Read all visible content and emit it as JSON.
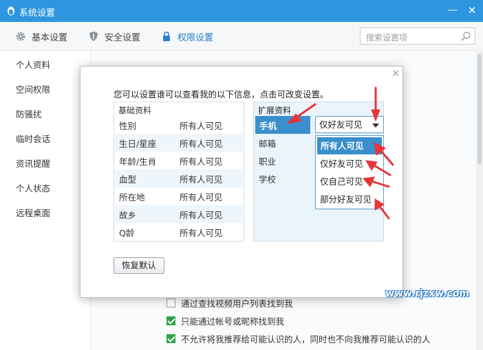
{
  "window": {
    "title": "系统设置",
    "minimize_icon": "minimize-icon",
    "close_icon": "close-icon"
  },
  "tabs": [
    {
      "label": "基本设置",
      "icon": "gear-icon"
    },
    {
      "label": "安全设置",
      "icon": "shield-icon"
    },
    {
      "label": "权限设置",
      "icon": "lock-icon",
      "active": true
    }
  ],
  "search": {
    "placeholder": "搜索设置项"
  },
  "sidebar": {
    "items": [
      {
        "label": "个人资料"
      },
      {
        "label": "空间权限"
      },
      {
        "label": "防骚扰"
      },
      {
        "label": "临时会话"
      },
      {
        "label": "资讯提醒"
      },
      {
        "label": "个人状态"
      },
      {
        "label": "远程桌面"
      }
    ]
  },
  "background_options": [
    {
      "label": "通过查找视频用户列表找到我",
      "checked": false
    },
    {
      "label": "只能通过帐号或昵称找到我",
      "checked": true
    },
    {
      "label": "不允许将我推荐给可能认识的人，同时也不向我推荐可能认识的人",
      "checked": true
    }
  ],
  "dialog": {
    "intro": "您可以设置谁可以查看我的以下信息，点击可改变设置。",
    "basic": {
      "header": "基础资料",
      "rows": [
        {
          "field": "性别",
          "value": "所有人可见"
        },
        {
          "field": "生日/星座",
          "value": "所有人可见"
        },
        {
          "field": "年龄/生肖",
          "value": "所有人可见"
        },
        {
          "field": "血型",
          "value": "所有人可见"
        },
        {
          "field": "所在地",
          "value": "所有人可见"
        },
        {
          "field": "故乡",
          "value": "所有人可见"
        },
        {
          "field": "Q龄",
          "value": "所有人可见"
        }
      ]
    },
    "extended": {
      "header": "扩展资料",
      "rows": [
        {
          "field": "手机",
          "selected": true
        },
        {
          "field": "邮箱"
        },
        {
          "field": "职业"
        },
        {
          "field": "学校"
        }
      ],
      "select_value": "仅好友可见",
      "options": [
        "所有人可见",
        "仅好友可见",
        "仅自己可见",
        "部分好友可见"
      ],
      "highlighted_option": "所有人可见"
    },
    "restore_label": "恢复默认"
  },
  "watermark": "www.rjzxw.com",
  "colors": {
    "titlebar": "#2d96df",
    "accent": "#2b7fd0",
    "selection": "#3a8fcc",
    "annotation": "#e8343a",
    "check": "#2fa34a"
  }
}
